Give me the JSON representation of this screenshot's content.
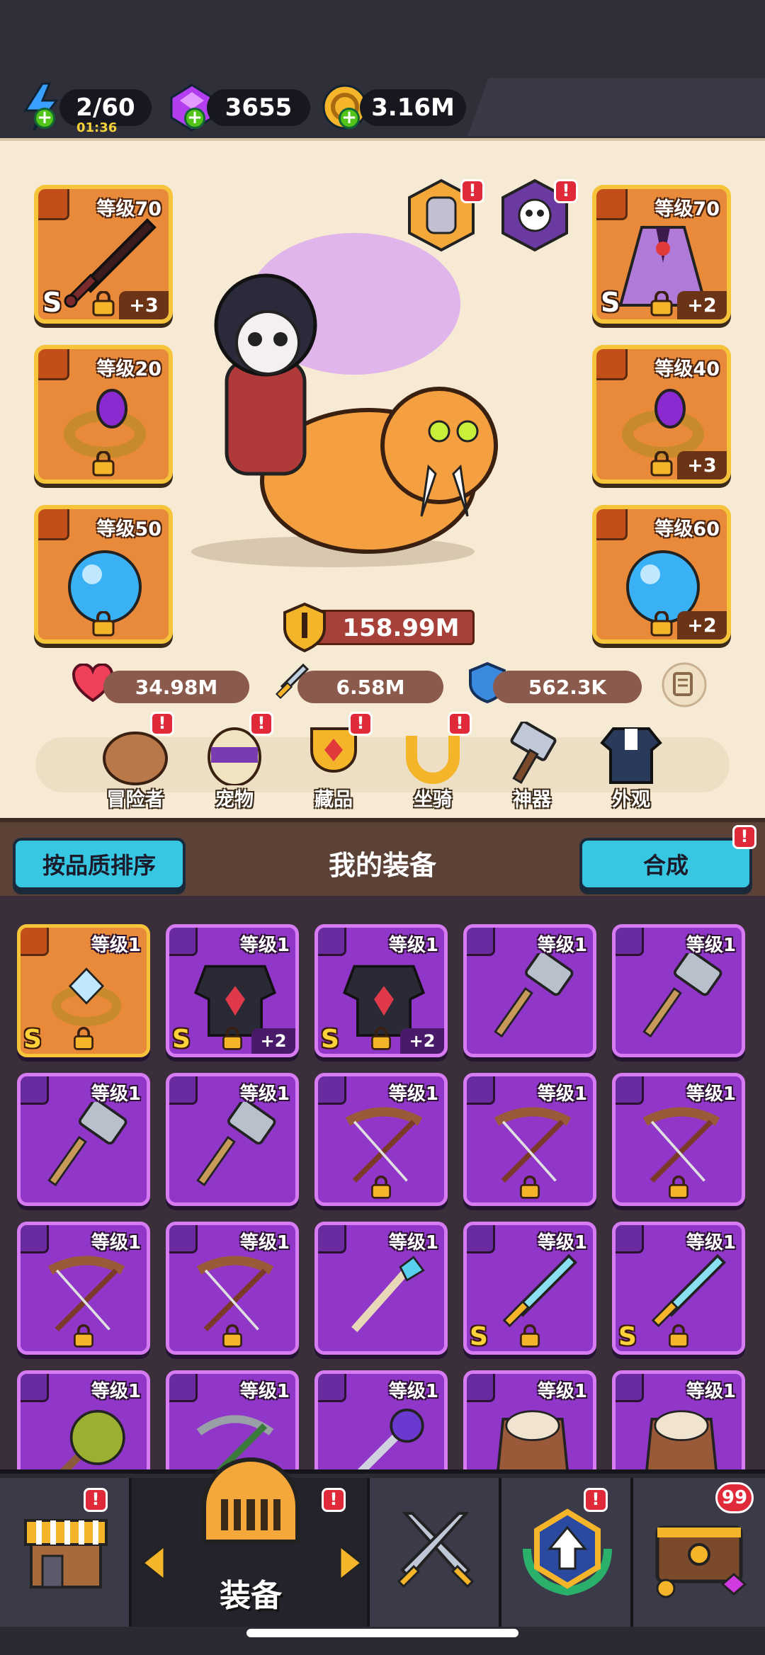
{
  "resources": {
    "energy": {
      "value": "2/60",
      "timer": "01:36",
      "icon": "lightning-icon"
    },
    "gems": {
      "value": "3655",
      "icon": "gem-icon"
    },
    "coins": {
      "value": "3.16M",
      "icon": "coin-icon"
    }
  },
  "equipped_left": [
    {
      "level": "等级70",
      "grade": "S",
      "plus": "+3",
      "item": "sword"
    },
    {
      "level": "等级20",
      "grade": "",
      "plus": "",
      "item": "ring"
    },
    {
      "level": "等级50",
      "grade": "",
      "plus": "",
      "item": "orb"
    }
  ],
  "equipped_right": [
    {
      "level": "等级70",
      "grade": "S",
      "plus": "+2",
      "item": "robe"
    },
    {
      "level": "等级40",
      "grade": "",
      "plus": "+3",
      "item": "ring"
    },
    {
      "level": "等级60",
      "grade": "",
      "plus": "+2",
      "item": "orb"
    }
  ],
  "power": "158.99M",
  "stats": {
    "hp": "34.98M",
    "attack": "6.58M",
    "defense": "562.3K"
  },
  "character_nav": [
    {
      "label": "冒险者",
      "alert": "!"
    },
    {
      "label": "宠物",
      "alert": "!"
    },
    {
      "label": "藏品",
      "alert": "!"
    },
    {
      "label": "坐骑",
      "alert": "!"
    },
    {
      "label": "神器",
      "alert": ""
    },
    {
      "label": "外观",
      "alert": ""
    }
  ],
  "equipment_header": {
    "sort_button": "按品质排序",
    "title": "我的装备",
    "merge_button": "合成",
    "merge_alert": "!"
  },
  "inventory": [
    {
      "level": "等级1",
      "grade": "S",
      "plus": "",
      "rarity": "orange",
      "item": "ring",
      "locked": true
    },
    {
      "level": "等级1",
      "grade": "S",
      "plus": "+2",
      "rarity": "purple",
      "item": "armor",
      "locked": true
    },
    {
      "level": "等级1",
      "grade": "S",
      "plus": "+2",
      "rarity": "purple",
      "item": "armor",
      "locked": true
    },
    {
      "level": "等级1",
      "grade": "",
      "plus": "",
      "rarity": "purple",
      "item": "hammer",
      "locked": false
    },
    {
      "level": "等级1",
      "grade": "",
      "plus": "",
      "rarity": "purple",
      "item": "hammer",
      "locked": false
    },
    {
      "level": "等级1",
      "grade": "",
      "plus": "",
      "rarity": "purple",
      "item": "hammer",
      "locked": false
    },
    {
      "level": "等级1",
      "grade": "",
      "plus": "",
      "rarity": "purple",
      "item": "hammer",
      "locked": false
    },
    {
      "level": "等级1",
      "grade": "",
      "plus": "",
      "rarity": "purple",
      "item": "bow",
      "locked": true
    },
    {
      "level": "等级1",
      "grade": "",
      "plus": "",
      "rarity": "purple",
      "item": "bow",
      "locked": true
    },
    {
      "level": "等级1",
      "grade": "",
      "plus": "",
      "rarity": "purple",
      "item": "bow",
      "locked": true
    },
    {
      "level": "等级1",
      "grade": "",
      "plus": "",
      "rarity": "purple",
      "item": "bow",
      "locked": true
    },
    {
      "level": "等级1",
      "grade": "",
      "plus": "",
      "rarity": "purple",
      "item": "bow",
      "locked": true
    },
    {
      "level": "等级1",
      "grade": "",
      "plus": "",
      "rarity": "purple",
      "item": "staff",
      "locked": false
    },
    {
      "level": "等级1",
      "grade": "S",
      "plus": "",
      "rarity": "purple",
      "item": "sword",
      "locked": true
    },
    {
      "level": "等级1",
      "grade": "S",
      "plus": "",
      "rarity": "purple",
      "item": "sword",
      "locked": true
    },
    {
      "level": "等级1",
      "grade": "",
      "plus": "",
      "rarity": "purple",
      "item": "mace",
      "locked": false
    },
    {
      "level": "等级1",
      "grade": "",
      "plus": "",
      "rarity": "purple",
      "item": "crossbow",
      "locked": false
    },
    {
      "level": "等级1",
      "grade": "",
      "plus": "",
      "rarity": "purple",
      "item": "wand",
      "locked": false
    },
    {
      "level": "等级1",
      "grade": "",
      "plus": "",
      "rarity": "purple",
      "item": "vest",
      "locked": false
    },
    {
      "level": "等级1",
      "grade": "",
      "plus": "",
      "rarity": "purple",
      "item": "vest",
      "locked": false
    }
  ],
  "bottom_nav": {
    "shop_alert": "!",
    "equip_label": "装备",
    "equip_alert": "!",
    "upgrade_alert": "!",
    "chest_badge": "99"
  },
  "colors": {
    "panel_bg": "#f6ead4",
    "purple_slot": "#9036c8",
    "orange_slot": "#e88a3a",
    "accent_cyan": "#38c7e3",
    "alert_red": "#e02a3a"
  }
}
